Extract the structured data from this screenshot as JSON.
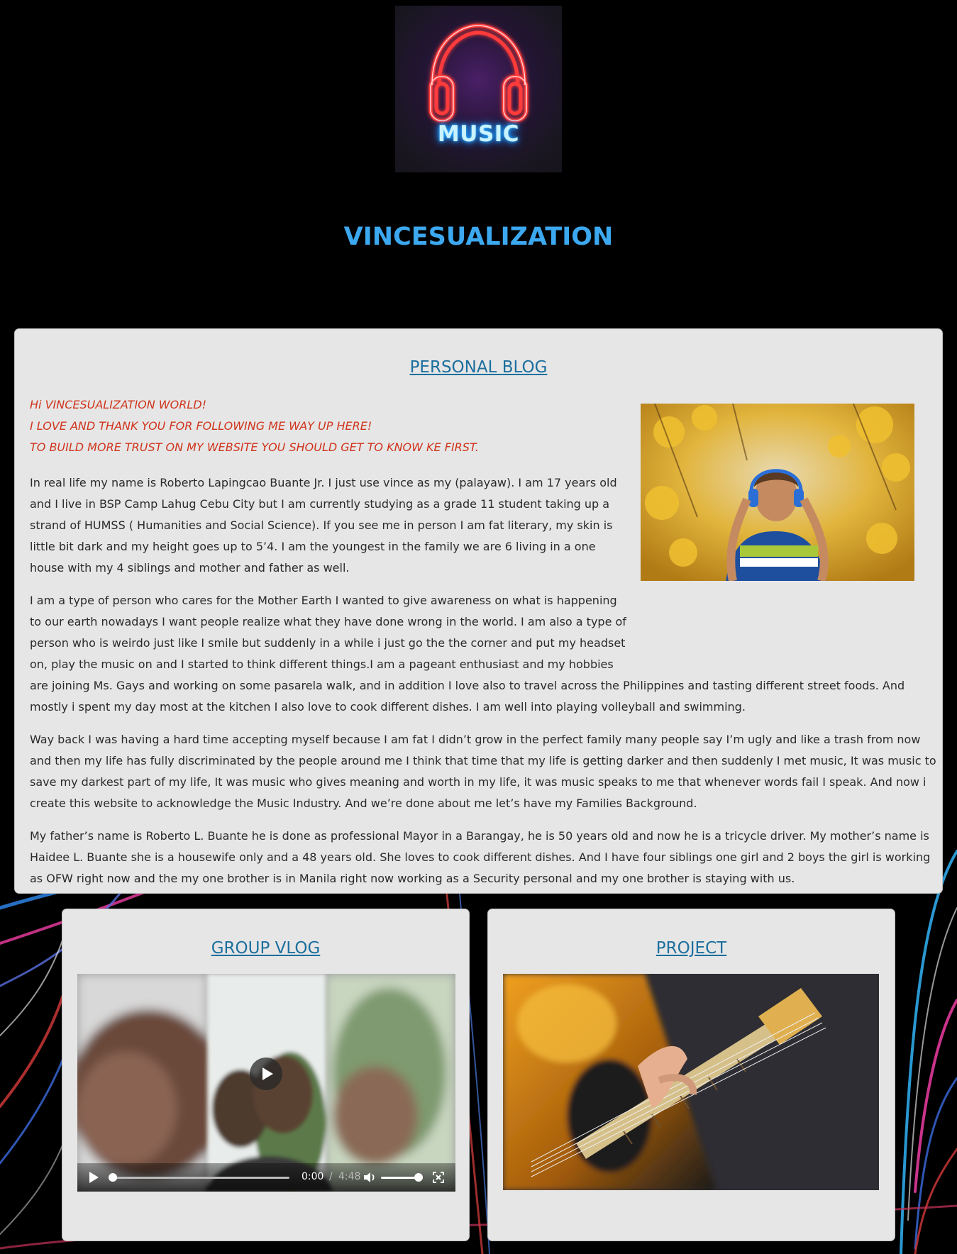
{
  "site": {
    "logo_text": "MUSIC",
    "title": "VINCESUALIZATION"
  },
  "blog": {
    "heading": "PERSONAL BLOG",
    "intro_lines": [
      "Hi VINCESUALIZATION WORLD!",
      "I LOVE AND THANK YOU FOR FOLLOWING ME WAY UP HERE!",
      "TO BUILD MORE TRUST ON MY WEBSITE YOU SHOULD GET TO KNOW KE FIRST."
    ],
    "paragraphs": [
      "In real life my name is Roberto Lapingcao Buante Jr. I just use vince as my (palayaw). I am 17 years old and I live in BSP Camp Lahug Cebu City but I am currently studying as a grade 11 student taking up a strand of HUMSS ( Humanities and Social Science). If you see me in person I am fat literary, my skin is little bit dark and my height goes up to 5’4. I am the youngest in the family we are 6 living in a one house with my 4 siblings and mother and father as well.",
      "I am a type of person who cares for the Mother Earth I wanted to give awareness on what is happening to our earth nowadays I want people realize what they have done wrong in the world. I am also a type of person who is weirdo just like I smile but suddenly in a while i just go the the corner and put my headset on, play the music on and I started to think different things.I am a pageant enthusiast and my hobbies are joining Ms. Gays and working on some pasarela walk, and in addition I love also to travel across the Philippines and tasting different street foods. And mostly i spent my day most at the kitchen I also love to cook different dishes. I am well into playing volleyball and swimming.",
      "Way back I was having a hard time accepting myself because I am fat I didn’t grow in the perfect family many people say I’m ugly and like a trash from now and then my life has fully discriminated by the people around me I think that time that my life is getting darker and then suddenly I met music, It was music to save my darkest part of my life, It was music who gives meaning and worth in my life, it was music speaks to me that whenever words fail I speak. And now i create this website to acknowledge the Music Industry. And we’re done about me let’s have my Families Background.",
      "My father’s name is Roberto L. Buante he is done as professional Mayor in a Barangay, he is 50 years old and now he is a tricycle driver. My mother’s name is Haidee L. Buante she is a housewife only and a 48 years old. She loves to cook different dishes. And I have four siblings one girl and 2 boys the girl is working as OFW right now and the my one brother is in Manila right now working as a Security personal and my one brother is staying with us."
    ]
  },
  "vlog": {
    "heading": "GROUP VLOG",
    "video": {
      "current_time": "0:00",
      "separator": "/",
      "total_time": "4:48",
      "progress": 0,
      "volume": 1
    }
  },
  "project": {
    "heading": "PROJECT"
  },
  "colors": {
    "background": "#000000",
    "title": "#3ca8f0",
    "heading_link": "#1c6f9e",
    "intro_text": "#d0341c",
    "card": "#e6e6e6"
  },
  "icons": [
    "headphones-icon",
    "play-icon",
    "volume-icon",
    "fullscreen-icon"
  ]
}
